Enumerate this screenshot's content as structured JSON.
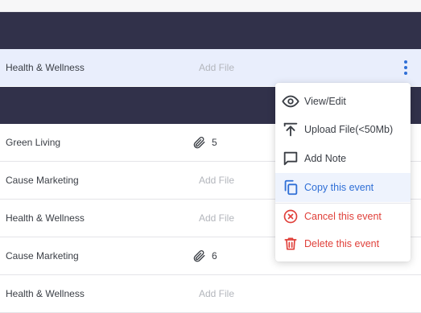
{
  "rows": [
    {
      "category": "Health & Wellness",
      "file": "Add File"
    },
    {
      "category": "Green Living",
      "attachments": "5"
    },
    {
      "category": "Cause Marketing",
      "file": "Add File"
    },
    {
      "category": "Health & Wellness",
      "file": "Add File"
    },
    {
      "category": "Cause Marketing",
      "attachments": "6"
    },
    {
      "category": "Health & Wellness",
      "file": "Add File"
    }
  ],
  "menu": {
    "view_edit": "View/Edit",
    "upload_file": "Upload File(<50Mb)",
    "add_note": "Add Note",
    "copy_event": "Copy this event",
    "cancel_event": "Cancel this event",
    "delete_event": "Delete this event"
  },
  "icons": {
    "kebab": "more-vertical-icon",
    "paperclip": "paperclip-icon",
    "view": "eye-icon",
    "upload": "upload-icon",
    "note": "note-icon",
    "copy": "copy-icon",
    "cancel": "cancel-circle-icon",
    "delete": "trash-icon"
  },
  "colors": {
    "header_dark": "#31314a",
    "active_row": "#e9eefc",
    "accent": "#2f6fd6",
    "danger": "#e0403a",
    "muted": "#b3b6bc"
  }
}
